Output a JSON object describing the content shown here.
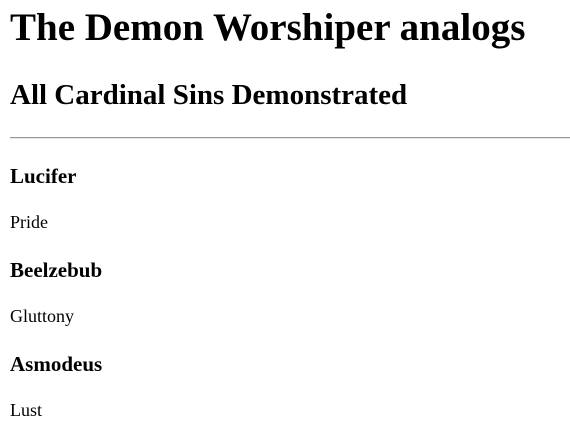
{
  "page": {
    "title": "The Demon Worshiper analogs",
    "subtitle": "All Cardinal Sins Demonstrated"
  },
  "entries": [
    {
      "name": "Lucifer",
      "sin": "Pride"
    },
    {
      "name": "Beelzebub",
      "sin": "Gluttony"
    },
    {
      "name": "Asmodeus",
      "sin": "Lust"
    }
  ]
}
